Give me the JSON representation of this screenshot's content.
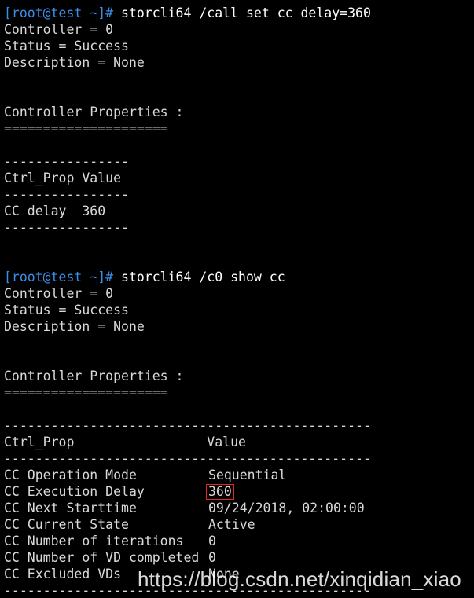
{
  "session1": {
    "prompt": "[root@test ~]#",
    "command": " storcli64 /call set cc delay=360",
    "controller": "Controller = 0",
    "status": "Status = Success",
    "description": "Description = None",
    "props_header": "Controller Properties :",
    "props_rule": "=====================",
    "rule_short": "----------------",
    "table_header": "Ctrl_Prop Value",
    "row": "CC delay  360"
  },
  "session2": {
    "prompt": "[root@test ~]#",
    "command": " storcli64 /c0 show cc",
    "controller": "Controller = 0",
    "status": "Status = Success",
    "description": "Description = None",
    "props_header": "Controller Properties :",
    "props_rule": "=====================",
    "rule_long": "-----------------------------------------------",
    "table_header": "Ctrl_Prop                 Value",
    "rows": [
      {
        "prop": "CC Operation Mode",
        "value": "Sequential"
      },
      {
        "prop": "CC Execution Delay",
        "value": "360"
      },
      {
        "prop": "CC Next Starttime",
        "value": "09/24/2018, 02:00:00"
      },
      {
        "prop": "CC Current State",
        "value": "Active"
      },
      {
        "prop": "CC Number of iterations",
        "value": "0"
      },
      {
        "prop": "CC Number of VD completed",
        "value": "0"
      },
      {
        "prop": "CC Excluded VDs",
        "value": "None"
      }
    ]
  },
  "watermark": "https://blog.csdn.net/xinqidian_xiao",
  "colors": {
    "background": "#000000",
    "text": "#d9d9d9",
    "prompt": "#3b8ee8",
    "highlight_border": "#e0262a"
  }
}
